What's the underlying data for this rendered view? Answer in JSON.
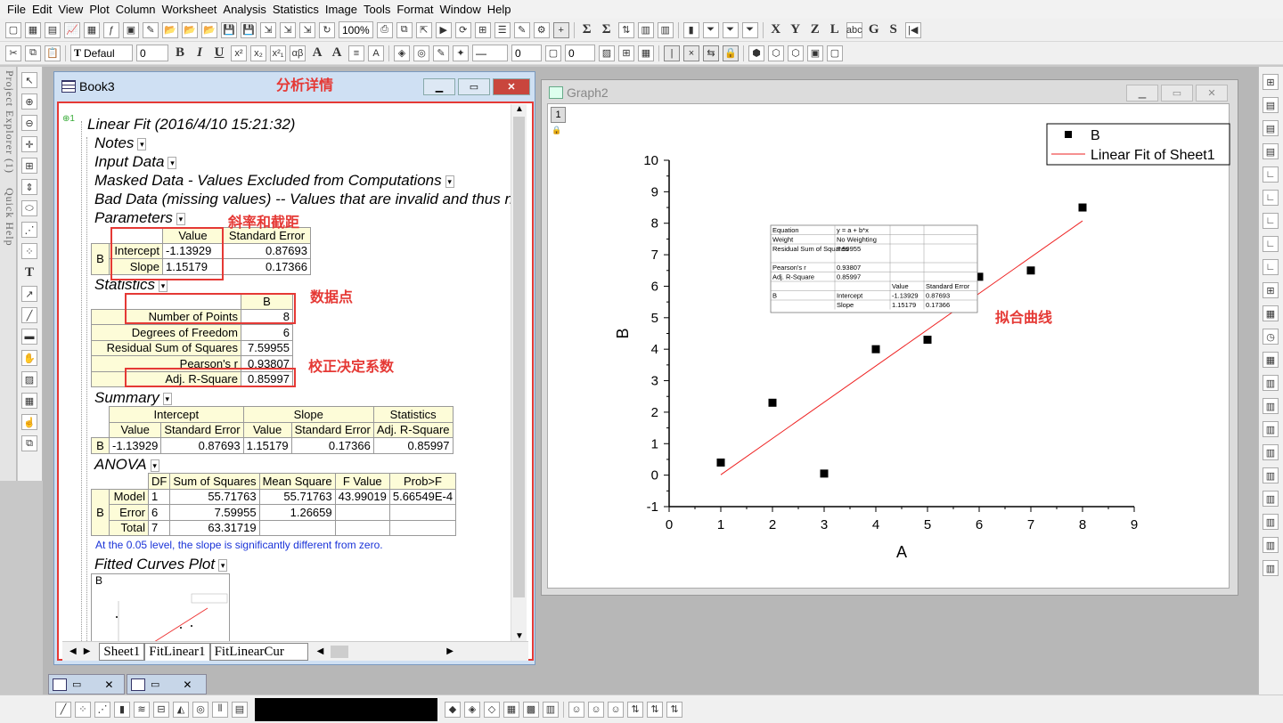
{
  "menu": [
    "File",
    "Edit",
    "View",
    "Plot",
    "Column",
    "Worksheet",
    "Analysis",
    "Statistics",
    "Image",
    "Tools",
    "Format",
    "Window",
    "Help"
  ],
  "toolbar": {
    "zoom": "100%",
    "font": "Defaul",
    "size": "0",
    "line_w": "0",
    "box_w": "0"
  },
  "side_tabs": [
    "Project Explorer (1)",
    "Quick Help"
  ],
  "book": {
    "title": "Book3",
    "annotation_title": "分析详情",
    "report_title": "Linear Fit (2016/4/10 15:21:32)",
    "sections": [
      "Notes",
      "Input Data",
      "Masked Data - Values Excluded from Computations",
      "Bad Data (missing values) -- Values that are invalid and thus n"
    ],
    "parameters": {
      "label": "Parameters",
      "headers": [
        "Value",
        "Standard Error"
      ],
      "row_group": "B",
      "rows": [
        {
          "name": "Intercept",
          "value": "-1.13929",
          "se": "0.87693"
        },
        {
          "name": "Slope",
          "value": "1.15179",
          "se": "0.17366"
        }
      ]
    },
    "statistics": {
      "label": "Statistics",
      "header": "B",
      "rows": [
        {
          "name": "Number of Points",
          "value": "8"
        },
        {
          "name": "Degrees of Freedom",
          "value": "6"
        },
        {
          "name": "Residual Sum of Squares",
          "value": "7.59955"
        },
        {
          "name": "Pearson's r",
          "value": "0.93807"
        },
        {
          "name": "Adj. R-Square",
          "value": "0.85997"
        }
      ]
    },
    "summary": {
      "label": "Summary",
      "groups": [
        "Intercept",
        "Slope",
        "Statistics"
      ],
      "headers": [
        "Value",
        "Standard Error",
        "Value",
        "Standard Error",
        "Adj. R-Square"
      ],
      "row": [
        "B",
        "-1.13929",
        "0.87693",
        "1.15179",
        "0.17366",
        "0.85997"
      ]
    },
    "anova": {
      "label": "ANOVA",
      "headers": [
        "DF",
        "Sum of Squares",
        "Mean Square",
        "F Value",
        "Prob>F"
      ],
      "group": "B",
      "rows": [
        [
          "Model",
          "1",
          "55.71763",
          "55.71763",
          "43.99019",
          "5.66549E-4"
        ],
        [
          "Error",
          "6",
          "7.59955",
          "1.26659",
          "",
          ""
        ],
        [
          "Total",
          "7",
          "63.31719",
          "",
          "",
          ""
        ]
      ]
    },
    "note": "At the 0.05 level, the slope is significantly different from zero.",
    "fitted_label": "Fitted Curves Plot",
    "thumb_label": "B",
    "annotations": {
      "params": "斜率和截距",
      "points": "数据点",
      "adj": "校正决定系数"
    },
    "tabs": [
      "Sheet1",
      "FitLinear1",
      "FitLinearCur"
    ]
  },
  "graph": {
    "title": "Graph2",
    "layer": "1",
    "fit_label": "拟合曲线",
    "legend": [
      "B",
      "Linear Fit of Sheet1"
    ],
    "table": {
      "rows": [
        [
          "Equation",
          "y = a + b*x",
          "",
          ""
        ],
        [
          "Weight",
          "No Weighting",
          "",
          ""
        ],
        [
          "Residual Sum of Squares",
          "7.59955",
          "",
          ""
        ],
        [
          "Pearson's r",
          "0.93807",
          "",
          ""
        ],
        [
          "Adj. R-Square",
          "0.85997",
          "",
          ""
        ],
        [
          "",
          "",
          "Value",
          "Standard Error"
        ],
        [
          "B",
          "Intercept",
          "-1.13929",
          "0.87693"
        ],
        [
          "",
          "Slope",
          "1.15179",
          "0.17366"
        ]
      ]
    }
  },
  "chart_data": {
    "type": "scatter",
    "xlabel": "A",
    "ylabel": "B",
    "xlim": [
      0,
      9
    ],
    "ylim": [
      -1,
      10
    ],
    "x_ticks": [
      "0",
      "1",
      "2",
      "3",
      "4",
      "5",
      "6",
      "7",
      "8",
      "9"
    ],
    "y_ticks": [
      "-1",
      "0",
      "1",
      "2",
      "3",
      "4",
      "5",
      "6",
      "7",
      "8",
      "9",
      "10"
    ],
    "series": [
      {
        "name": "B",
        "x": [
          1,
          2,
          3,
          4,
          5,
          6,
          7,
          8
        ],
        "y": [
          0.4,
          2.3,
          0.05,
          4.0,
          4.3,
          6.3,
          6.5,
          8.5
        ]
      }
    ],
    "fit": {
      "name": "Linear Fit of Sheet1",
      "intercept": -1.13929,
      "slope": 1.15179,
      "x": [
        1,
        8
      ]
    },
    "legend_position": "top-right",
    "grid": false
  }
}
